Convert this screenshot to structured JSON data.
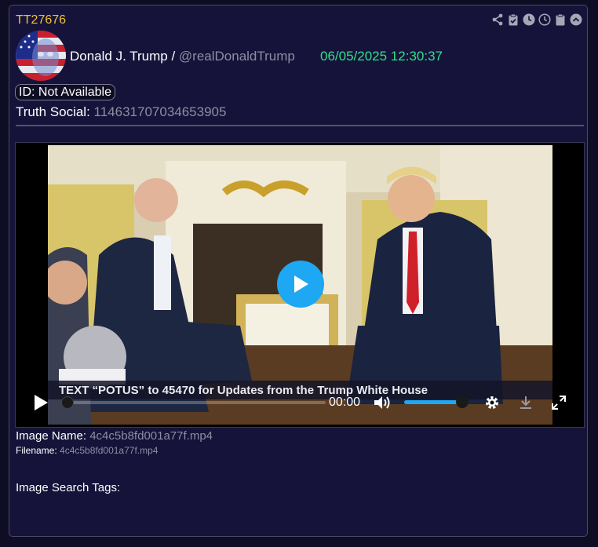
{
  "post": {
    "id": "TT27676",
    "author_name": "Donald J. Trump",
    "separator": " / ",
    "handle": "@realDonaldTrump",
    "timestamp": "06/05/2025 12:30:37",
    "id_badge": "ID: Not Available",
    "truth_label": "Truth Social: ",
    "truth_value": "114631707034653905"
  },
  "toolbar": {
    "icons": [
      "share-icon",
      "clipboard-check-icon",
      "clock-filled-icon",
      "clock-outline-icon",
      "clipboard-icon",
      "chevron-up-circle-icon"
    ]
  },
  "video": {
    "caption": "TEXT “POTUS” to 45470 for Updates from the Trump White House",
    "time": "00:00",
    "progress": 0,
    "volume": 1.0,
    "accent_color": "#1ea7f2"
  },
  "media": {
    "image_name_label": "Image Name: ",
    "image_name_value": "4c4c5b8fd001a77f.mp4",
    "filename_label": "Filename: ",
    "filename_value": "4c4c5b8fd001a77f.mp4",
    "tags_label": "Image Search Tags:"
  },
  "colors": {
    "post_id": "#f0c232",
    "timestamp": "#2fe08a",
    "muted": "#8f8ca3",
    "background": "#16133a"
  }
}
